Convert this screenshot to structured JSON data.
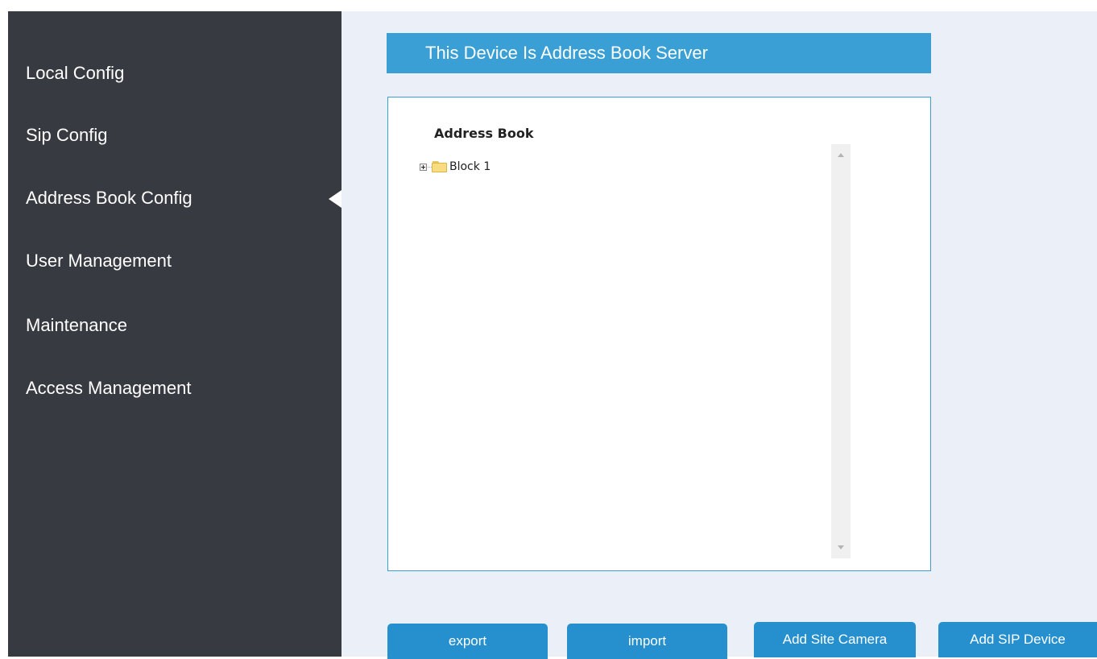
{
  "sidebar": {
    "items": [
      {
        "label": "Local Config"
      },
      {
        "label": "Sip Config"
      },
      {
        "label": "Address Book Config",
        "active": true
      },
      {
        "label": "User Management"
      },
      {
        "label": "Maintenance"
      },
      {
        "label": "Access Management"
      }
    ]
  },
  "main": {
    "title": "This Device Is Address Book Server",
    "panel": {
      "heading": "Address Book",
      "tree": [
        {
          "label": "Block 1",
          "icon": "folder-icon",
          "expander": "plus"
        }
      ]
    },
    "buttons": {
      "export": "export",
      "import": "import",
      "add_site_camera": "Add Site Camera",
      "add_sip_device": "Add SIP Device"
    }
  },
  "colors": {
    "sidebar_bg": "#373a41",
    "main_bg": "#ebf0f8",
    "accent": "#3a9fd4",
    "button": "#268fcd"
  }
}
